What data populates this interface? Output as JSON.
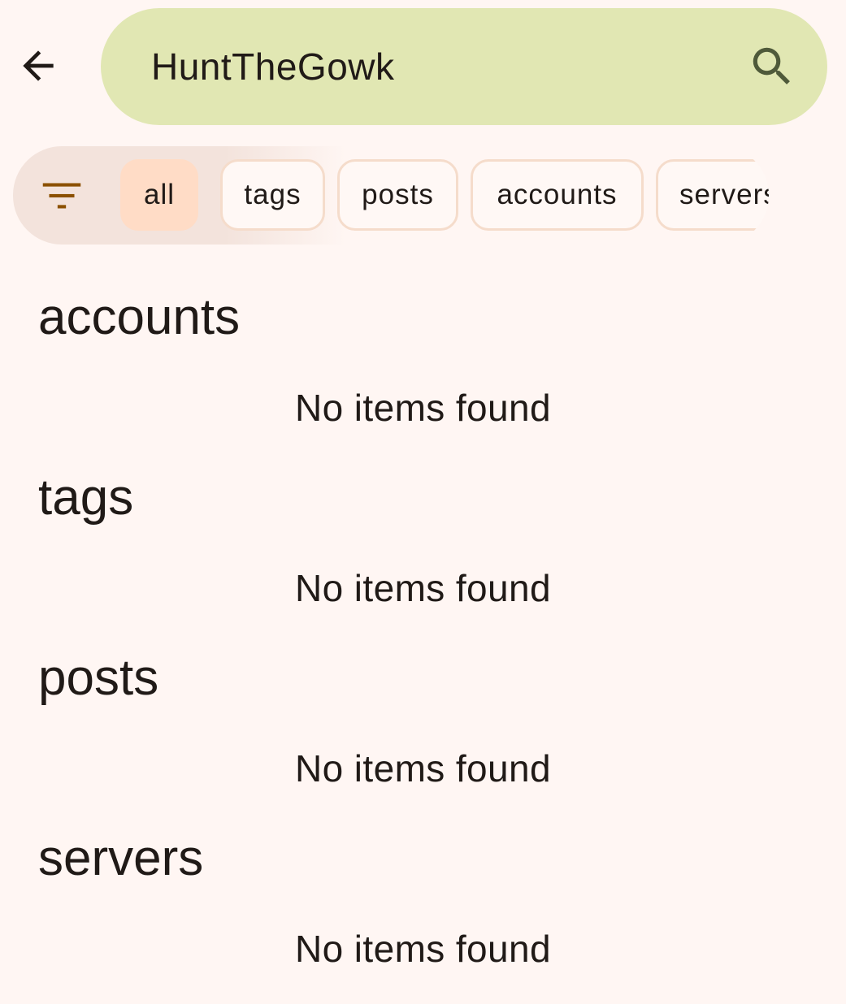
{
  "header": {
    "back_icon": "arrow-back-icon",
    "search_query": "HuntTheGowk",
    "search_icon": "search-icon",
    "search_bar_color": "#e1e7b3"
  },
  "filters": {
    "filter_icon": "filter-list-icon",
    "chips": [
      {
        "label": "all",
        "selected": true
      },
      {
        "label": "tags",
        "selected": false
      },
      {
        "label": "posts",
        "selected": false
      },
      {
        "label": "accounts",
        "selected": false
      },
      {
        "label": "servers",
        "selected": false
      }
    ]
  },
  "sections": [
    {
      "title": "accounts",
      "empty_message": "No items found"
    },
    {
      "title": "tags",
      "empty_message": "No items found"
    },
    {
      "title": "posts",
      "empty_message": "No items found"
    },
    {
      "title": "servers",
      "empty_message": "No items found"
    }
  ],
  "colors": {
    "background": "#fff6f3",
    "selected_chip": "#ffdcc6",
    "chip_border": "#f5dccb",
    "filter_icon": "#8b5000"
  }
}
